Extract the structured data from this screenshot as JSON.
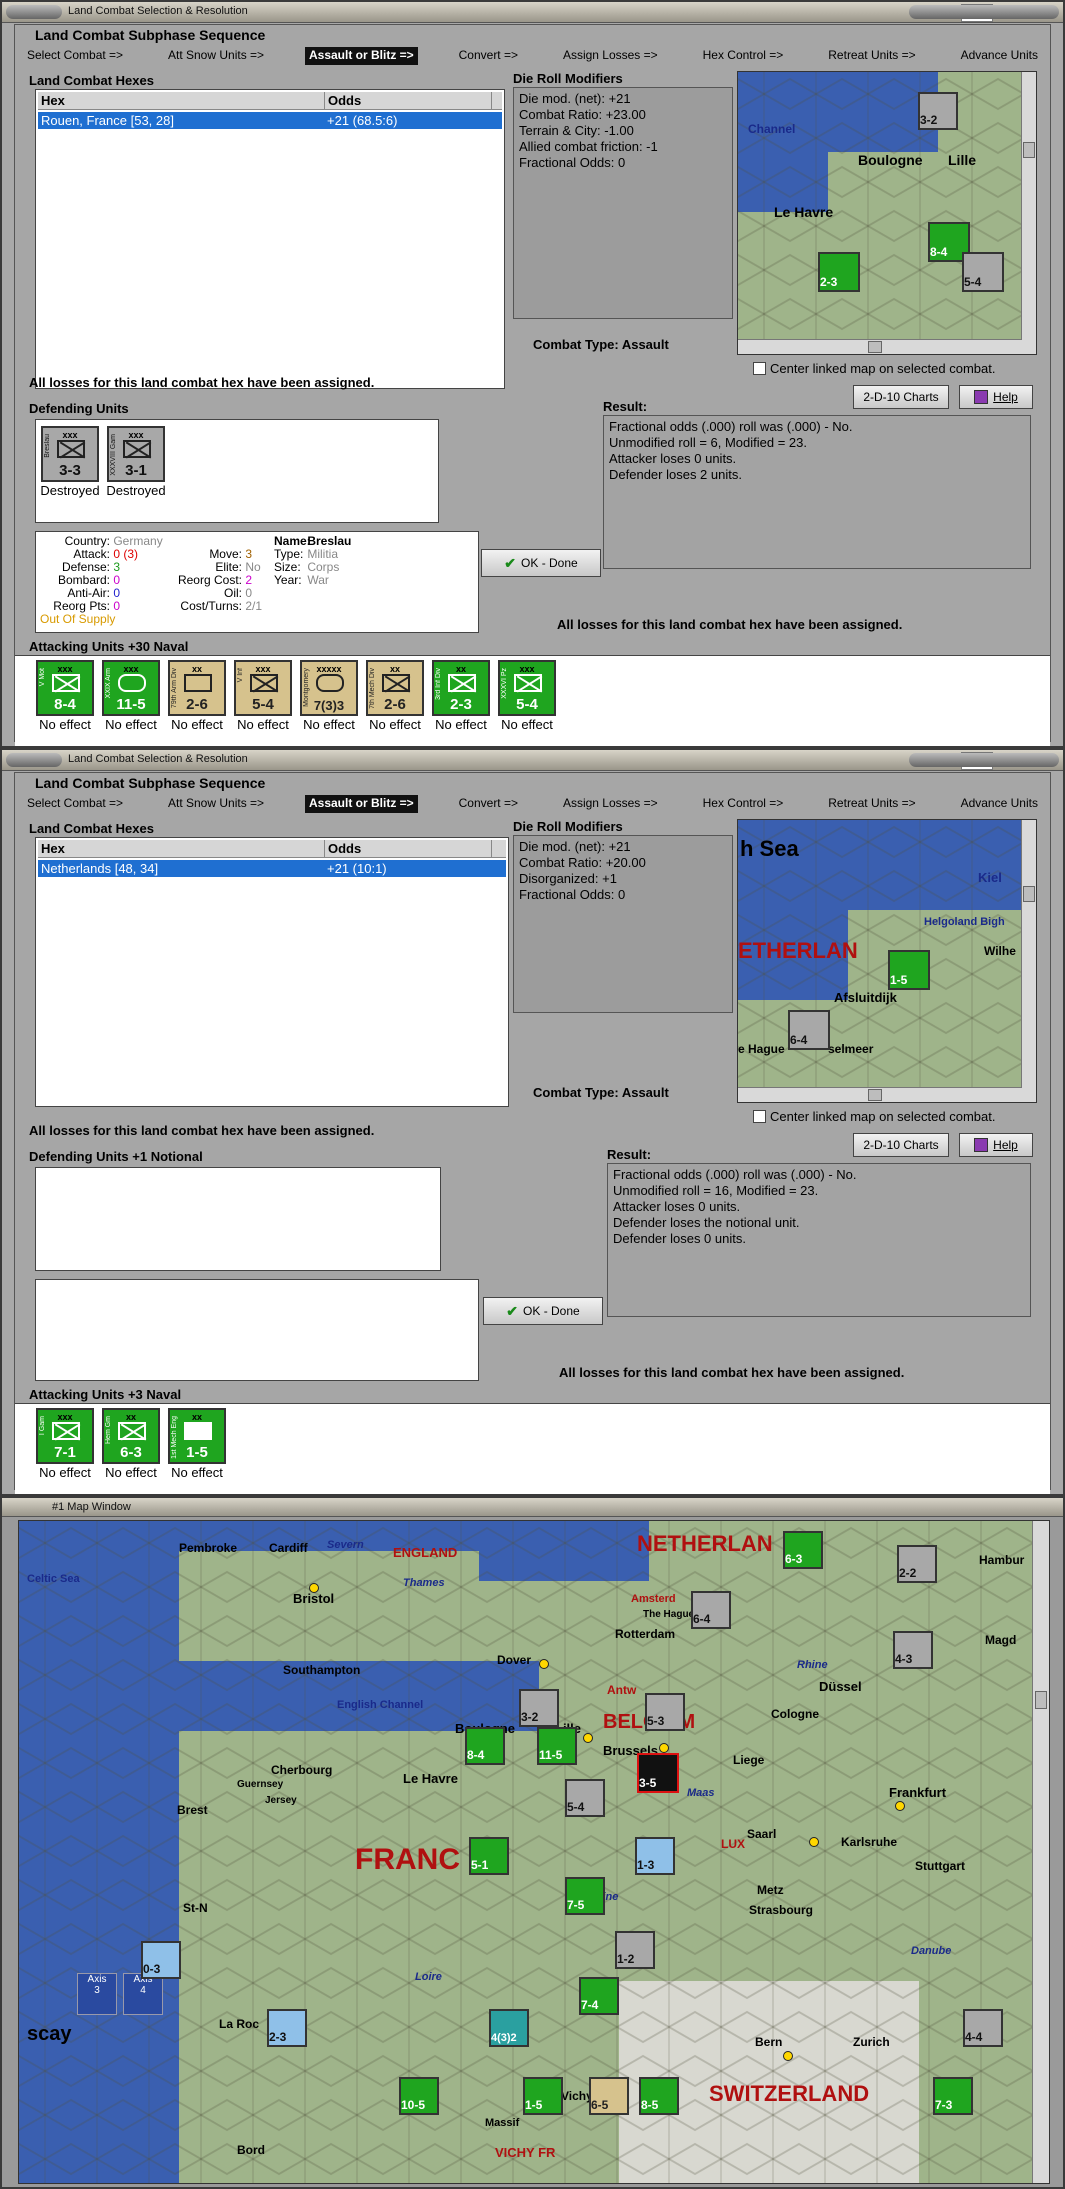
{
  "window1": {
    "title": "Land Combat Selection & Resolution",
    "subphase_title": "Land Combat Subphase Sequence",
    "sequence": [
      "Select Combat =>",
      "Att Snow Units =>",
      "Assault or Blitz =>",
      "Convert =>",
      "Assign Losses =>",
      "Hex Control =>",
      "Retreat Units =>",
      "Advance Units"
    ],
    "hexes_label": "Land Combat Hexes",
    "hex_col": "Hex",
    "odds_col": "Odds",
    "hex_row": {
      "hex": "Rouen, France [53, 28]",
      "odds": "+21 (68.5:6)"
    },
    "modifiers_label": "Die Roll Modifiers",
    "modifiers": [
      "Die mod. (net): +21",
      "",
      "Combat Ratio: +23.00",
      "Terrain & City: -1.00",
      "Allied combat friction: -1",
      "Fractional Odds: 0"
    ],
    "combat_type": "Combat Type:  Assault",
    "losses_msg": "All losses for this land combat hex have been assigned.",
    "defending_label": "Defending Units",
    "defenders": [
      {
        "size": "xxx",
        "name": "Breslau",
        "strength": "3-3",
        "effect": "Destroyed"
      },
      {
        "size": "xxx",
        "name": "XXXVIII Gam",
        "strength": "3-1",
        "effect": "Destroyed"
      }
    ],
    "unit_info": {
      "country_k": "Country:",
      "country_v": "Germany",
      "attack_k": "Attack:",
      "attack_v": "0",
      "attack_v2": "(3)",
      "defense_k": "Defense:",
      "defense_v": "3",
      "bombard_k": "Bombard:",
      "bombard_v": "0",
      "antiair_k": "Anti-Air:",
      "antiair_v": "0",
      "reorg_k": "Reorg Pts:",
      "reorg_v": "0",
      "supply": "Out Of Supply",
      "move_k": "Move:",
      "move_v": "3",
      "elite_k": "Elite:",
      "elite_v": "No",
      "reorgcost_k": "Reorg Cost:",
      "reorgcost_v": "2",
      "oil_k": "Oil:",
      "oil_v": "0",
      "cost_k": "Cost/Turns:",
      "cost_v": "2/1",
      "name_k": "Name:",
      "name_v": "Breslau",
      "type_k": "Type:",
      "type_v": "Militia",
      "size_k": "Size:",
      "size_v": "Corps",
      "year_k": "Year:",
      "year_v": "War"
    },
    "ok_button": "OK - Done",
    "result_label": "Result:",
    "result": [
      "Fractional odds (.000) roll was (.000)  - No.",
      "Unmodified roll = 6, Modified = 23.",
      "Attacker loses 0 units.",
      "Defender loses 2 units."
    ],
    "charts_button": "2-D-10 Charts",
    "help_button": "Help",
    "center_linked": "Center linked map on selected combat.",
    "map_labels": [
      "Channel",
      "Boulogne",
      "Lille",
      "Le Havre"
    ],
    "attacking_label": "Attacking Units +30 Naval",
    "attackers": [
      {
        "size": "xxx",
        "name": "V Mot",
        "strength": "8-4",
        "effect": "No effect",
        "color": "green"
      },
      {
        "size": "xxx",
        "name": "XXIX Arm",
        "strength": "11-5",
        "effect": "No effect",
        "color": "green"
      },
      {
        "size": "xx",
        "name": "79th Arm Div",
        "strength": "2-6",
        "effect": "No effect",
        "color": "tan"
      },
      {
        "size": "xxx",
        "name": "V Inf",
        "strength": "5-4",
        "effect": "No effect",
        "color": "tan"
      },
      {
        "size": "xxxxx",
        "name": "Montgomery",
        "strength": "7(3)3",
        "effect": "No effect",
        "color": "tan"
      },
      {
        "size": "xx",
        "name": "7th Mech Div",
        "strength": "2-6",
        "effect": "No effect",
        "color": "tan"
      },
      {
        "size": "xx",
        "name": "3rd Inf Div",
        "strength": "2-3",
        "effect": "No effect",
        "color": "green"
      },
      {
        "size": "xxx",
        "name": "XXXVI Pz",
        "strength": "5-4",
        "effect": "No effect",
        "color": "green"
      }
    ]
  },
  "window2": {
    "title": "Land Combat Selection & Resolution",
    "subphase_title": "Land Combat Subphase Sequence",
    "sequence": [
      "Select Combat =>",
      "Att Snow Units =>",
      "Assault or Blitz =>",
      "Convert =>",
      "Assign Losses =>",
      "Hex Control =>",
      "Retreat Units =>",
      "Advance Units"
    ],
    "hexes_label": "Land Combat Hexes",
    "hex_col": "Hex",
    "odds_col": "Odds",
    "hex_row": {
      "hex": "Netherlands [48, 34]",
      "odds": "+21 (10:1)"
    },
    "modifiers_label": "Die Roll Modifiers",
    "modifiers": [
      "Die mod. (net): +21",
      "",
      "Combat Ratio: +20.00",
      "Disorganized: +1",
      "Fractional Odds: 0"
    ],
    "combat_type": "Combat Type:  Assault",
    "losses_msg": "All losses for this land combat hex have been assigned.",
    "defending_label": "Defending Units +1 Notional",
    "ok_button": "OK - Done",
    "result_label": "Result:",
    "result": [
      "Fractional odds (.000) roll was (.000)  - No.",
      "Unmodified roll = 16, Modified = 23.",
      "Attacker loses 0 units.",
      "Defender loses the notional unit.",
      "Defender loses 0 units."
    ],
    "charts_button": "2-D-10 Charts",
    "help_button": "Help",
    "center_linked": "Center linked map on selected combat.",
    "map_labels": [
      "h Sea",
      "Kiel",
      "Helgoland Bigh",
      "ETHERLAN",
      "Afsluitdijk",
      "Wilhe",
      "e Hague",
      "selmeer"
    ],
    "attacking_label": "Attacking Units +3 Naval",
    "attackers": [
      {
        "size": "xxx",
        "name": "I Gam",
        "strength": "7-1",
        "effect": "No effect",
        "color": "green"
      },
      {
        "size": "xx",
        "name": "Hem Gm",
        "strength": "6-3",
        "effect": "No effect",
        "color": "green"
      },
      {
        "size": "xx",
        "name": "1st Mech Eng",
        "strength": "1-5",
        "effect": "No effect",
        "color": "green"
      }
    ]
  },
  "mapwin": {
    "title": "#1 Map Window",
    "labels": {
      "pembroke": "Pembroke",
      "cardiff": "Cardiff",
      "severn": "Severn",
      "england": "ENGLAND",
      "celtic": "Celtic Sea",
      "bristol": "Bristol",
      "thames": "Thames",
      "southampton": "Southampton",
      "dover": "Dover",
      "channel": "English Channel",
      "boulogne": "Boulogne",
      "lille": "Lille",
      "cherbourg": "Cherbourg",
      "guernsey": "Guernsey",
      "jersey": "Jersey",
      "lehavre": "Le Havre",
      "brest": "Brest",
      "france": "FRANC",
      "stn": "St-N",
      "biscay": "scay",
      "larochelle": "La Roc",
      "bord": "Bord",
      "vichy": "Vichy",
      "vichyfrance": "VICHY FR",
      "netherland": "NETHERLAN",
      "amsterdam": "Amsterd",
      "thehague": "The Hague",
      "rotterdam": "Rotterdam",
      "antw": "Antw",
      "belgium": "BELGIUM",
      "brussels": "Brussels",
      "liege": "Liege",
      "dussel": "Düssel",
      "cologne": "Cologne",
      "frankfurt": "Frankfurt",
      "maas": "Maas",
      "saarl": "Saarl",
      "karlsruhe": "Karlsruhe",
      "stuttgart": "Stuttgart",
      "metz": "Metz",
      "strasbourg": "Strasbourg",
      "lux": "LUX",
      "seine": "Seine",
      "loire": "Loire",
      "danube": "Danube",
      "rhine": "Rhine",
      "bern": "Bern",
      "zurich": "Zurich",
      "switzerland": "SWITZERLAND",
      "hambur": "Hambur",
      "magd": "Magd",
      "massif": "Massif"
    },
    "axis_boxes": [
      {
        "label": "Axis",
        "value": "3"
      },
      {
        "label": "Axis",
        "value": "4"
      }
    ],
    "counters": [
      "3-5",
      "6-3",
      "2-2",
      "6-4",
      "4-3",
      "5-4",
      "3-2",
      "5-3",
      "11-5",
      "8-4",
      "7-5",
      "1-3",
      "5-1",
      "7-4",
      "2-3",
      "10-5",
      "4(3)2",
      "6-5",
      "8-5",
      "7-3",
      "1-5",
      "4-4",
      "0-3",
      "1-2"
    ]
  }
}
